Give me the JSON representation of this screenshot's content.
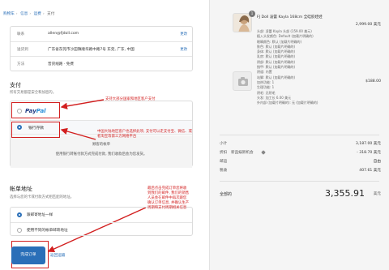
{
  "breadcrumb": [
    "购物车",
    "信息",
    "运费",
    "支付"
  ],
  "info": [
    {
      "key": "联系",
      "value": "allen@fjdoll.com",
      "change": "更改"
    },
    {
      "key": "送货到",
      "value": "广东省东莞市沙田镇顺华路中路7号 东莞, 广东, 中国",
      "change": "更改"
    },
    {
      "key": "方法",
      "value": "普货线路 · 免费",
      "change": ""
    }
  ],
  "payment": {
    "title": "支付",
    "subtitle": "所有交易都是安全和加密的。",
    "paypal_p1": "Pay",
    "paypal_p2": "Pal",
    "bank_label": "银行存款",
    "bank_desc_1": "顾客的帐单",
    "bank_desc_2": "使用银行转账付款方式完成付款, 我们收款后会为您发货。"
  },
  "annotations": {
    "paypal_note": "支持大部分国家和地区客户支付",
    "bank_note": "中国大陆地区客户也选择此项, 支付可以走支付宝、微信、或者淘宝等第三方网络平台",
    "submit_note": "最后点击完成订单您将收到我们的邮件, 我们的销售人员会在邮件中再次跟您确认订单信息, 并确认生产周期和支付周期相关信息"
  },
  "billing": {
    "title": "帐单地址",
    "subtitle": "选择与您的卡或付款方式相匹配的地址。",
    "options": [
      "跟邮寄地址一样",
      "使用不同的帐单邮寄地址"
    ]
  },
  "actions": {
    "complete": "完成订单",
    "return": "返回运输"
  },
  "order": {
    "qty": "1",
    "product_title": "FJ Doll 凌蕾 Kayla 168cm 全硅胶娃娃",
    "product_price": "2,999.00 美元",
    "options": [
      "头部: 凌蕾 Kayla 头部 (159.00 美元)",
      "植入头发颜色: Default (加载片明确的)",
      "眼睛颜色: 默认 (加载片明确的)",
      "肤色: 默认 (加载片明确的)",
      "身体: 默认 (加载片明确的)",
      "乳房: 默认 (加载片明确的)",
      "阴部: 默认 (加载片明确的)",
      "指甲: 默认 (加载片明确的)",
      "阴道: 内置",
      "站脚: 默认 (加载片明确的)",
      "加热功能: 1",
      "生理功能: 1",
      "阴毛: 无阴毛",
      "头发: 加工长 6.00 美元",
      "外内部 (加载片明确的): 无 (加载片明确的)"
    ],
    "option_price": "$188.00",
    "subtotal_label": "小计",
    "subtotal": "3,187.00 美元",
    "discount_label": "折扣",
    "discount_code": "新品娱新机会",
    "discount": "- 318.70 美元",
    "shipping_label": "邮运",
    "shipping": "自由",
    "tax_label": "税收",
    "tax": "407.61 美元",
    "total_label": "全部的",
    "total": "3,355.91",
    "currency": "美元"
  }
}
